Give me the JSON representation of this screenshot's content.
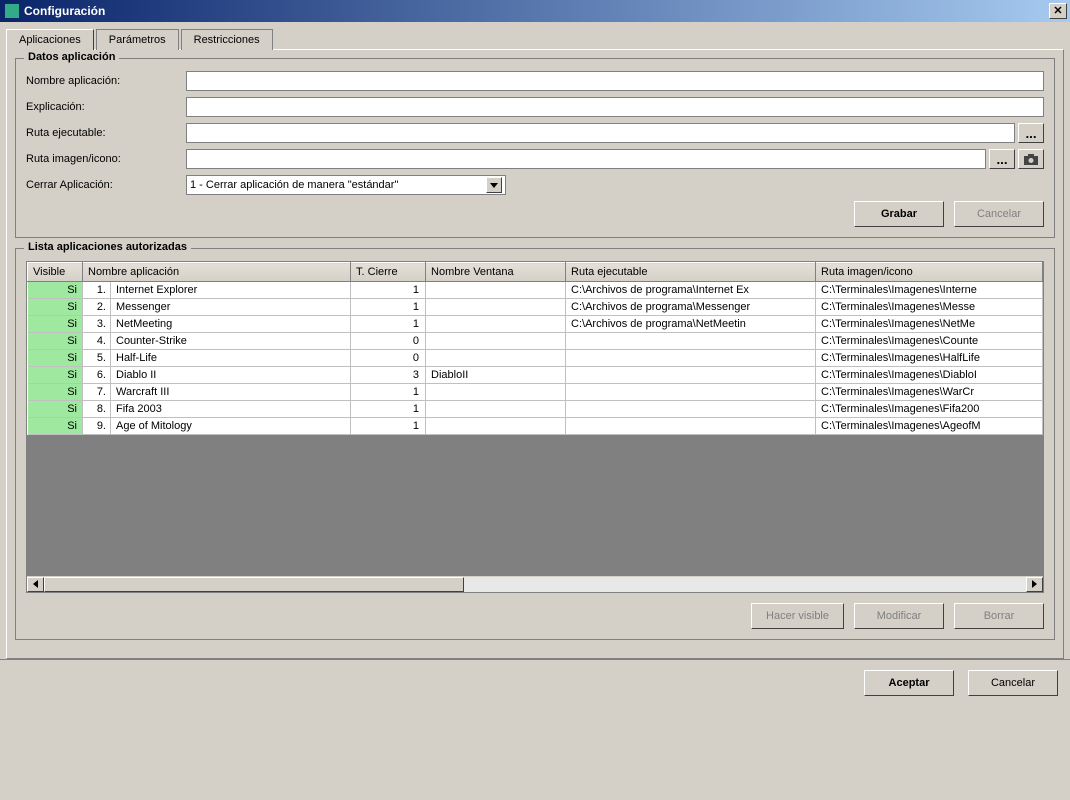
{
  "window": {
    "title": "Configuración"
  },
  "tabs": [
    {
      "label": "Aplicaciones"
    },
    {
      "label": "Parámetros"
    },
    {
      "label": "Restricciones"
    }
  ],
  "group_datos": {
    "title": "Datos aplicación",
    "labels": {
      "nombre": "Nombre aplicación:",
      "explicacion": "Explicación:",
      "ruta_exe": "Ruta ejecutable:",
      "ruta_img": "Ruta imagen/icono:",
      "cerrar": "Cerrar Aplicación:"
    },
    "values": {
      "nombre": "",
      "explicacion": "",
      "ruta_exe": "",
      "ruta_img": "",
      "cerrar_option": "1 - Cerrar aplicación de manera \"estándar\""
    },
    "browse_label": "...",
    "buttons": {
      "grabar": "Grabar",
      "cancelar": "Cancelar"
    }
  },
  "group_lista": {
    "title": "Lista aplicaciones autorizadas",
    "columns": {
      "visible": "Visible",
      "nombre": "Nombre aplicación",
      "tcierre": "T. Cierre",
      "ventana": "Nombre Ventana",
      "ruta_exe": "Ruta ejecutable",
      "ruta_img": "Ruta imagen/icono"
    },
    "rows": [
      {
        "visible": "Si",
        "idx": "1.",
        "nombre": "Internet Explorer",
        "tcierre": "1",
        "ventana": "",
        "ruta_exe": "C:\\Archivos de programa\\Internet Ex",
        "ruta_img": "C:\\Terminales\\Imagenes\\Interne"
      },
      {
        "visible": "Si",
        "idx": "2.",
        "nombre": "Messenger",
        "tcierre": "1",
        "ventana": "",
        "ruta_exe": "C:\\Archivos de programa\\Messenger",
        "ruta_img": "C:\\Terminales\\Imagenes\\Messe"
      },
      {
        "visible": "Si",
        "idx": "3.",
        "nombre": "NetMeeting",
        "tcierre": "1",
        "ventana": "",
        "ruta_exe": "C:\\Archivos de programa\\NetMeetin",
        "ruta_img": "C:\\Terminales\\Imagenes\\NetMe"
      },
      {
        "visible": "Si",
        "idx": "4.",
        "nombre": "Counter-Strike",
        "tcierre": "0",
        "ventana": "",
        "ruta_exe": "",
        "ruta_img": "C:\\Terminales\\Imagenes\\Counte"
      },
      {
        "visible": "Si",
        "idx": "5.",
        "nombre": "Half-Life",
        "tcierre": "0",
        "ventana": "",
        "ruta_exe": "",
        "ruta_img": "C:\\Terminales\\Imagenes\\HalfLife"
      },
      {
        "visible": "Si",
        "idx": "6.",
        "nombre": "Diablo II",
        "tcierre": "3",
        "ventana": "DiabloII",
        "ruta_exe": "",
        "ruta_img": "C:\\Terminales\\Imagenes\\DiabloI"
      },
      {
        "visible": "Si",
        "idx": "7.",
        "nombre": "Warcraft III",
        "tcierre": "1",
        "ventana": "",
        "ruta_exe": "",
        "ruta_img": "C:\\Terminales\\Imagenes\\WarCr"
      },
      {
        "visible": "Si",
        "idx": "8.",
        "nombre": "Fifa 2003",
        "tcierre": "1",
        "ventana": "",
        "ruta_exe": "",
        "ruta_img": "C:\\Terminales\\Imagenes\\Fifa200"
      },
      {
        "visible": "Si",
        "idx": "9.",
        "nombre": "Age of Mitology",
        "tcierre": "1",
        "ventana": "",
        "ruta_exe": "",
        "ruta_img": "C:\\Terminales\\Imagenes\\AgeofM"
      }
    ],
    "buttons": {
      "hacer_visible": "Hacer visible",
      "modificar": "Modificar",
      "borrar": "Borrar"
    }
  },
  "footer": {
    "aceptar": "Aceptar",
    "cancelar": "Cancelar"
  }
}
